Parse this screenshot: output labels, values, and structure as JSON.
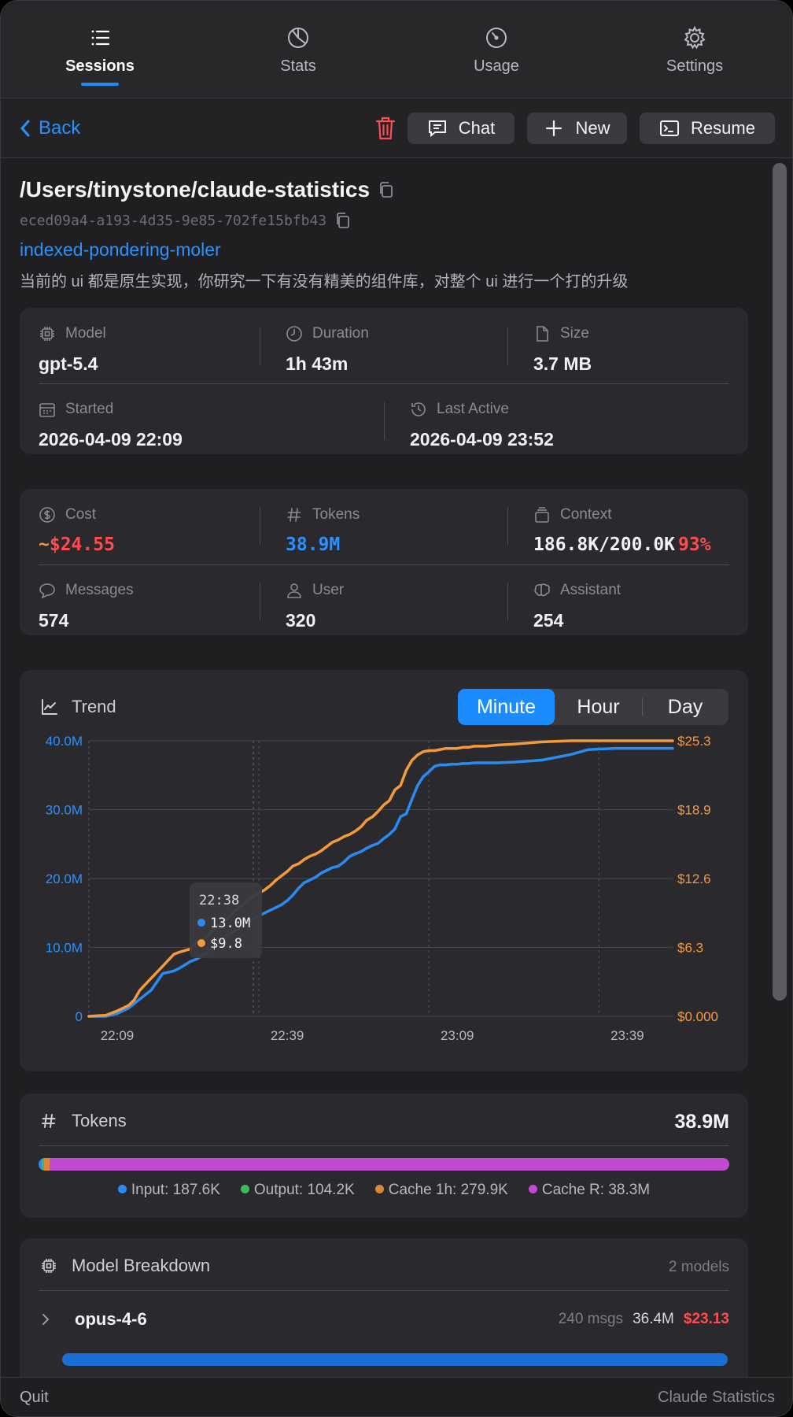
{
  "tabs": [
    {
      "label": "Sessions",
      "icon": "list-icon",
      "active": true
    },
    {
      "label": "Stats",
      "icon": "pie-chart-icon",
      "active": false
    },
    {
      "label": "Usage",
      "icon": "gauge-icon",
      "active": false
    },
    {
      "label": "Settings",
      "icon": "gear-icon",
      "active": false
    }
  ],
  "toolbar": {
    "back_label": "Back",
    "chat_label": "Chat",
    "new_label": "New",
    "resume_label": "Resume"
  },
  "session": {
    "path": "/Users/tinystone/claude-statistics",
    "id": "eced09a4-a193-4d35-9e85-702fe15bfb43",
    "slug": "indexed-pondering-moler",
    "description": "当前的 ui 都是原生实现，你研究一下有没有精美的组件库，对整个 ui 进行一个打的升级"
  },
  "info": {
    "model_label": "Model",
    "model_value": "gpt-5.4",
    "duration_label": "Duration",
    "duration_value": "1h 43m",
    "size_label": "Size",
    "size_value": "3.7 MB",
    "started_label": "Started",
    "started_value": "2026-04-09 22:09",
    "last_active_label": "Last Active",
    "last_active_value": "2026-04-09 23:52"
  },
  "metrics": {
    "cost_label": "Cost",
    "cost_prefix": "~",
    "cost_value": "$24.55",
    "tokens_label": "Tokens",
    "tokens_value": "38.9M",
    "context_label": "Context",
    "context_value": "186.8K/200.0K",
    "context_pct": "93%",
    "messages_label": "Messages",
    "messages_value": "574",
    "user_label": "User",
    "user_value": "320",
    "assistant_label": "Assistant",
    "assistant_value": "254"
  },
  "trend": {
    "title": "Trend",
    "segments": [
      "Minute",
      "Hour",
      "Day"
    ],
    "active_segment": "Minute",
    "tooltip": {
      "time": "22:38",
      "tokens": "13.0M",
      "cost": "$9.8"
    }
  },
  "chart_data": {
    "type": "line",
    "x_labels": [
      "22:09",
      "22:39",
      "23:09",
      "23:39"
    ],
    "x_range_minutes": [
      0,
      103
    ],
    "y_left_ticks": [
      "0",
      "10.0M",
      "20.0M",
      "30.0M",
      "40.0M"
    ],
    "y_left_range": [
      0,
      40.0
    ],
    "y_right_ticks": [
      "$0.000",
      "$6.3",
      "$12.6",
      "$18.9",
      "$25.3"
    ],
    "y_right_range": [
      0,
      25.3
    ],
    "grid": true,
    "highlight_x": 29,
    "series": [
      {
        "color": "#2a8bf2",
        "axis": "left",
        "x": [
          0,
          3,
          5,
          7,
          9,
          11,
          13,
          15,
          16,
          18,
          19,
          20,
          21,
          22,
          23,
          24,
          25,
          26,
          27,
          28,
          29,
          30,
          31,
          32,
          33,
          34,
          35,
          36,
          37,
          38,
          39,
          40,
          41,
          42,
          43,
          44,
          45,
          46,
          47,
          48,
          49,
          50,
          51,
          52,
          53,
          54,
          55,
          56,
          57,
          58,
          59,
          60,
          61,
          62,
          63,
          64,
          65,
          66,
          67,
          68,
          70,
          72,
          75,
          80,
          85,
          88,
          90,
          93,
          96,
          100,
          103
        ],
        "y": [
          0,
          0,
          0.4,
          1.2,
          2.5,
          3.8,
          6.2,
          6.6,
          7.0,
          8.0,
          8.3,
          8.8,
          9.4,
          10.2,
          10.8,
          11.5,
          12.0,
          12.6,
          13.0,
          13.6,
          14.2,
          14.6,
          15.0,
          15.4,
          15.8,
          16.2,
          16.8,
          17.6,
          18.6,
          19.4,
          19.8,
          20.2,
          20.8,
          21.2,
          21.6,
          21.8,
          22.4,
          23.2,
          23.6,
          23.9,
          24.4,
          24.8,
          25.1,
          25.8,
          26.4,
          27.2,
          29.0,
          29.4,
          31.5,
          33.5,
          34.8,
          35.5,
          36.3,
          36.5,
          36.5,
          36.6,
          36.6,
          36.7,
          36.7,
          36.8,
          36.8,
          36.8,
          36.9,
          37.2,
          38.0,
          38.7,
          38.8,
          38.9,
          38.9,
          38.9,
          38.9
        ]
      },
      {
        "color": "#f59a3a",
        "axis": "right",
        "x": [
          0,
          3,
          5,
          7,
          8,
          9,
          11,
          13,
          15,
          16,
          18,
          19,
          20,
          21,
          22,
          23,
          24,
          25,
          26,
          27,
          28,
          29,
          30,
          31,
          32,
          33,
          34,
          35,
          36,
          37,
          38,
          39,
          40,
          41,
          42,
          43,
          44,
          45,
          46,
          47,
          48,
          49,
          50,
          51,
          52,
          53,
          54,
          55,
          56,
          57,
          58,
          59,
          60,
          61,
          62,
          63,
          64,
          65,
          66,
          67,
          68,
          70,
          72,
          75,
          80,
          85,
          88,
          90,
          93,
          96,
          100,
          103
        ],
        "y": [
          0,
          0.1,
          0.5,
          1.0,
          1.5,
          2.4,
          3.5,
          4.6,
          5.7,
          5.9,
          6.2,
          6.8,
          7.0,
          7.4,
          8.0,
          8.4,
          8.8,
          9.3,
          9.8,
          10.2,
          10.6,
          11.0,
          11.3,
          11.6,
          12.0,
          12.5,
          12.9,
          13.3,
          13.8,
          14.0,
          14.4,
          14.7,
          14.9,
          15.2,
          15.6,
          16.0,
          16.2,
          16.5,
          16.7,
          17.0,
          17.4,
          18.0,
          18.3,
          18.8,
          19.4,
          19.8,
          20.8,
          21.2,
          22.6,
          23.5,
          24.0,
          24.3,
          24.4,
          24.4,
          24.5,
          24.6,
          24.6,
          24.6,
          24.7,
          24.7,
          24.8,
          24.8,
          24.9,
          25.0,
          25.2,
          25.3,
          25.3,
          25.3,
          25.3,
          25.3,
          25.3,
          25.3
        ]
      }
    ]
  },
  "tokens": {
    "title": "Tokens",
    "total": "38.9M",
    "segments": [
      {
        "label": "Input: 187.6K",
        "value": 187.6,
        "color": "#2a8bf2"
      },
      {
        "label": "Output: 104.2K",
        "value": 104.2,
        "color": "#3dbb5c"
      },
      {
        "label": "Cache 1h: 279.9K",
        "value": 279.9,
        "color": "#e0843a"
      },
      {
        "label": "Cache R: 38.3M",
        "value": 38300,
        "color": "#c04bd0"
      }
    ]
  },
  "models": {
    "title": "Model Breakdown",
    "count": "2 models",
    "items": [
      {
        "name": "opus-4-6",
        "msgs": "240 msgs",
        "tokens": "36.4M",
        "cost": "$23.13",
        "share": 1.0
      }
    ]
  },
  "footer": {
    "quit_label": "Quit",
    "app_name": "Claude Statistics"
  },
  "colors": {
    "accent": "#1a8cff",
    "cost": "#ff4d4f",
    "orange": "#f59a3a"
  }
}
